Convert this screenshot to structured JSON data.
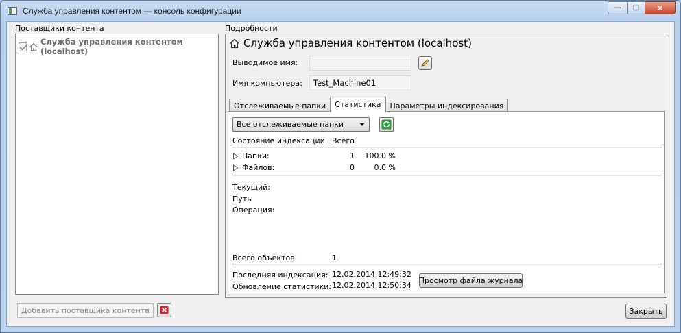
{
  "window": {
    "title": "Служба управления контентом — консоль конфигурации",
    "minimize_glyph": "—",
    "maximize_glyph": "□",
    "close_glyph": "✕"
  },
  "providers": {
    "group_label": "Поставщики контента",
    "items": [
      {
        "label": "Служба управления контентом (localhost)",
        "checked": true
      }
    ],
    "add_combo_placeholder": "Добавить поставщика контента"
  },
  "details": {
    "group_label": "Подробности",
    "title": "Служба управления контентом (localhost)",
    "display_name_label": "Выводимое имя:",
    "display_name_value": "",
    "computer_name_label": "Имя компьютера:",
    "computer_name_value": "Test_Machine01",
    "tabs": [
      {
        "label": "Отслеживаемые папки",
        "active": false
      },
      {
        "label": "Статистика",
        "active": true
      },
      {
        "label": "Параметры индексирования",
        "active": false
      }
    ],
    "stats": {
      "folder_filter": "Все отслеживаемые папки",
      "col_state": "Состояние индексации",
      "col_total": "Всего",
      "rows": [
        {
          "label": "Папки:",
          "count": "1",
          "percent": "100.0 %"
        },
        {
          "label": "Файлов:",
          "count": "0",
          "percent": "0.0 %"
        }
      ],
      "current_label": "Текущий:",
      "path_label": "Путь",
      "operation_label": "Операция:",
      "total_objects_label": "Всего объектов:",
      "total_objects_value": "1",
      "last_index_label": "Последняя индексация:",
      "last_index_value": "12.02.2014 12:49:32",
      "stats_update_label": "Обновление статистики:",
      "stats_update_value": "12.02.2014 12:50:34",
      "view_log_button": "Просмотр файла журнала"
    }
  },
  "footer": {
    "close_button": "Закрыть"
  },
  "colors": {
    "title_bg": "#bcd3ee",
    "close_btn": "#c9452a",
    "client_bg": "#f0f0f0",
    "refresh_green": "#2e9a3a",
    "delete_red": "#d4242a"
  }
}
